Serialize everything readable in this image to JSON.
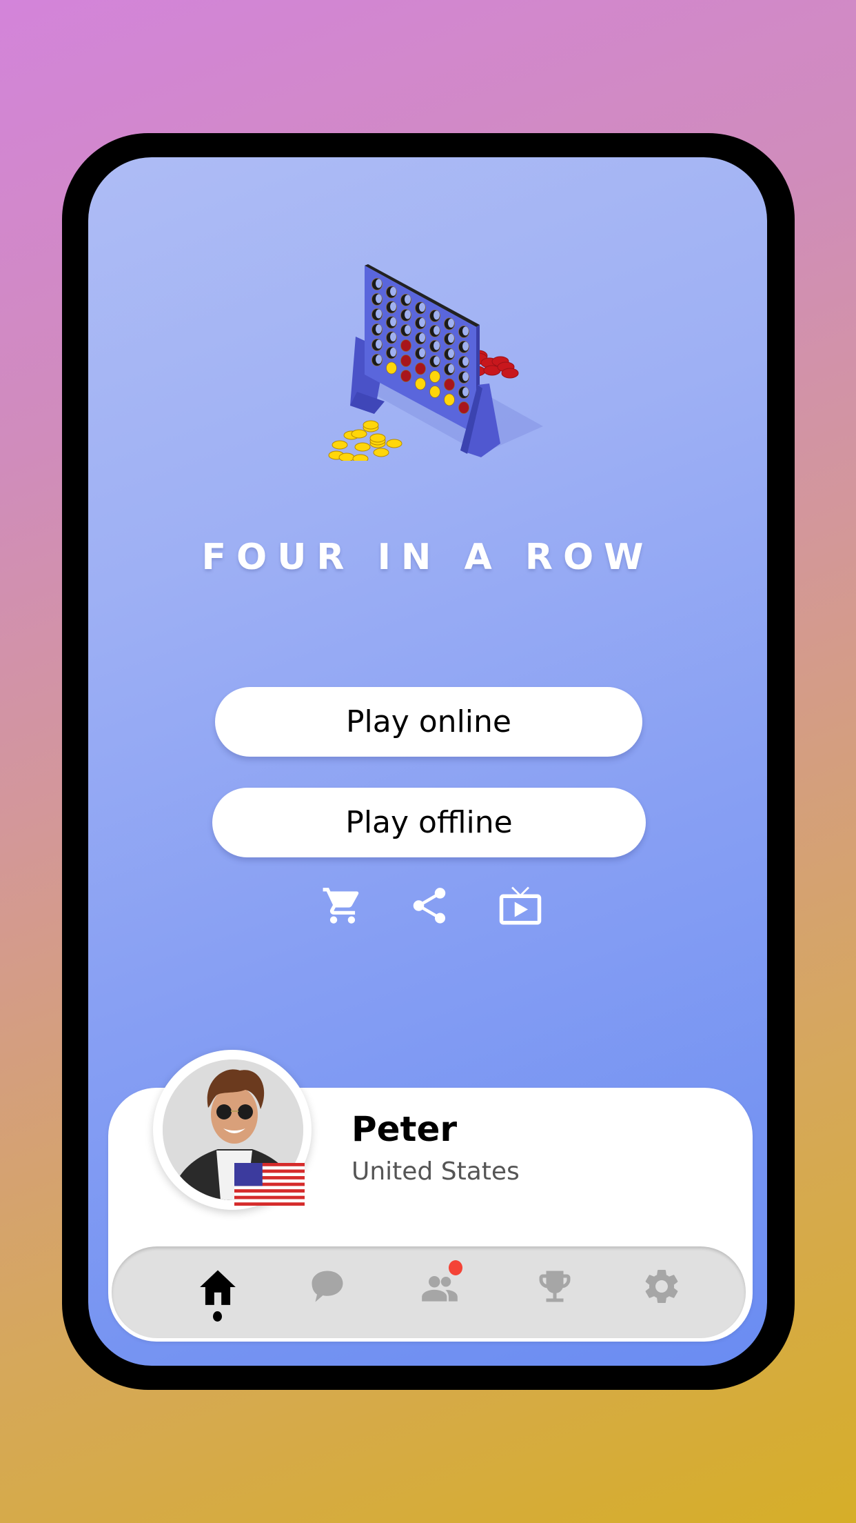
{
  "app": {
    "title": "FOUR IN A ROW",
    "hero_image": "connect-four-board-illustration"
  },
  "actions": {
    "play_online_label": "Play online",
    "play_offline_label": "Play offline",
    "quick_icons": [
      {
        "name": "cart-icon",
        "label": "Shop"
      },
      {
        "name": "share-icon",
        "label": "Share"
      },
      {
        "name": "tv-play-icon",
        "label": "Watch video"
      }
    ]
  },
  "profile": {
    "name": "Peter",
    "country": "United States",
    "flag": "us-flag-icon",
    "avatar": "user-avatar-photo"
  },
  "bottom_nav": {
    "active_index": 0,
    "items": [
      {
        "name": "home",
        "icon": "home-icon",
        "active": true,
        "badge": false
      },
      {
        "name": "chat",
        "icon": "chat-bubble-icon",
        "active": false,
        "badge": false
      },
      {
        "name": "friends",
        "icon": "friends-icon",
        "active": false,
        "badge": true
      },
      {
        "name": "leaderboard",
        "icon": "trophy-icon",
        "active": false,
        "badge": false
      },
      {
        "name": "settings",
        "icon": "gear-icon",
        "active": false,
        "badge": false
      }
    ]
  },
  "colors": {
    "screen_gradient_start": "#aebcf5",
    "screen_gradient_end": "#6a8cf2",
    "badge": "#f44336",
    "nav_inactive": "#a6a6a6",
    "nav_active": "#000000",
    "red_disc": "#a8151c",
    "yellow_disc": "#ffd60a",
    "board": "#5560d8"
  }
}
